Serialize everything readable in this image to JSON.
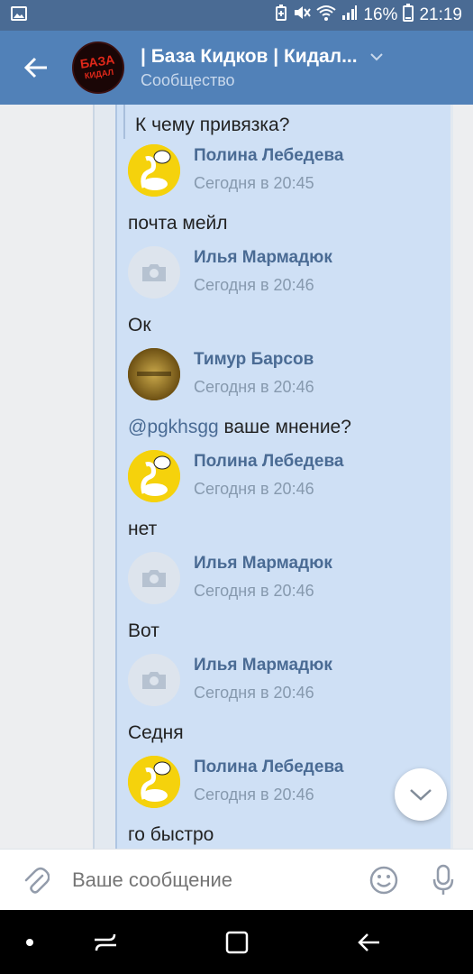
{
  "status_bar": {
    "battery": "16%",
    "time": "21:19"
  },
  "header": {
    "title": "| База Кидков | Кидал...",
    "subtitle": "Сообщество",
    "avatar_text_1": "БАЗА",
    "avatar_text_2": "КИДАЛ"
  },
  "chat": {
    "top_message": "К чему привязка?",
    "messages": [
      {
        "author": "Полина Лебедева",
        "time": "Сегодня в 20:45",
        "text": "почта мейл",
        "avatar": "yellow"
      },
      {
        "author": "Илья Мармадюк",
        "time": "Сегодня в 20:46",
        "text": "Ок",
        "avatar": "gray"
      },
      {
        "author": "Тимур Барсов",
        "time": "Сегодня в 20:46",
        "mention": "@pgkhsgg",
        "text": " ваше мнение?",
        "avatar": "brown"
      },
      {
        "author": "Полина Лебедева",
        "time": "Сегодня в 20:46",
        "text": "нет",
        "avatar": "yellow"
      },
      {
        "author": "Илья Мармадюк",
        "time": "Сегодня в 20:46",
        "text": "Вот",
        "avatar": "gray"
      },
      {
        "author": "Илья Мармадюк",
        "time": "Сегодня в 20:46",
        "text": "Седня",
        "avatar": "gray"
      },
      {
        "author": "Полина Лебедева",
        "time": "Сегодня в 20:46",
        "text": "го быстро",
        "avatar": "yellow"
      }
    ]
  },
  "composer": {
    "placeholder": "Ваше сообщение"
  },
  "colors": {
    "header_bg": "#5181b8",
    "status_bg": "#4a6b94",
    "link": "#4a6b94",
    "bubble": "#cfe0f5"
  }
}
